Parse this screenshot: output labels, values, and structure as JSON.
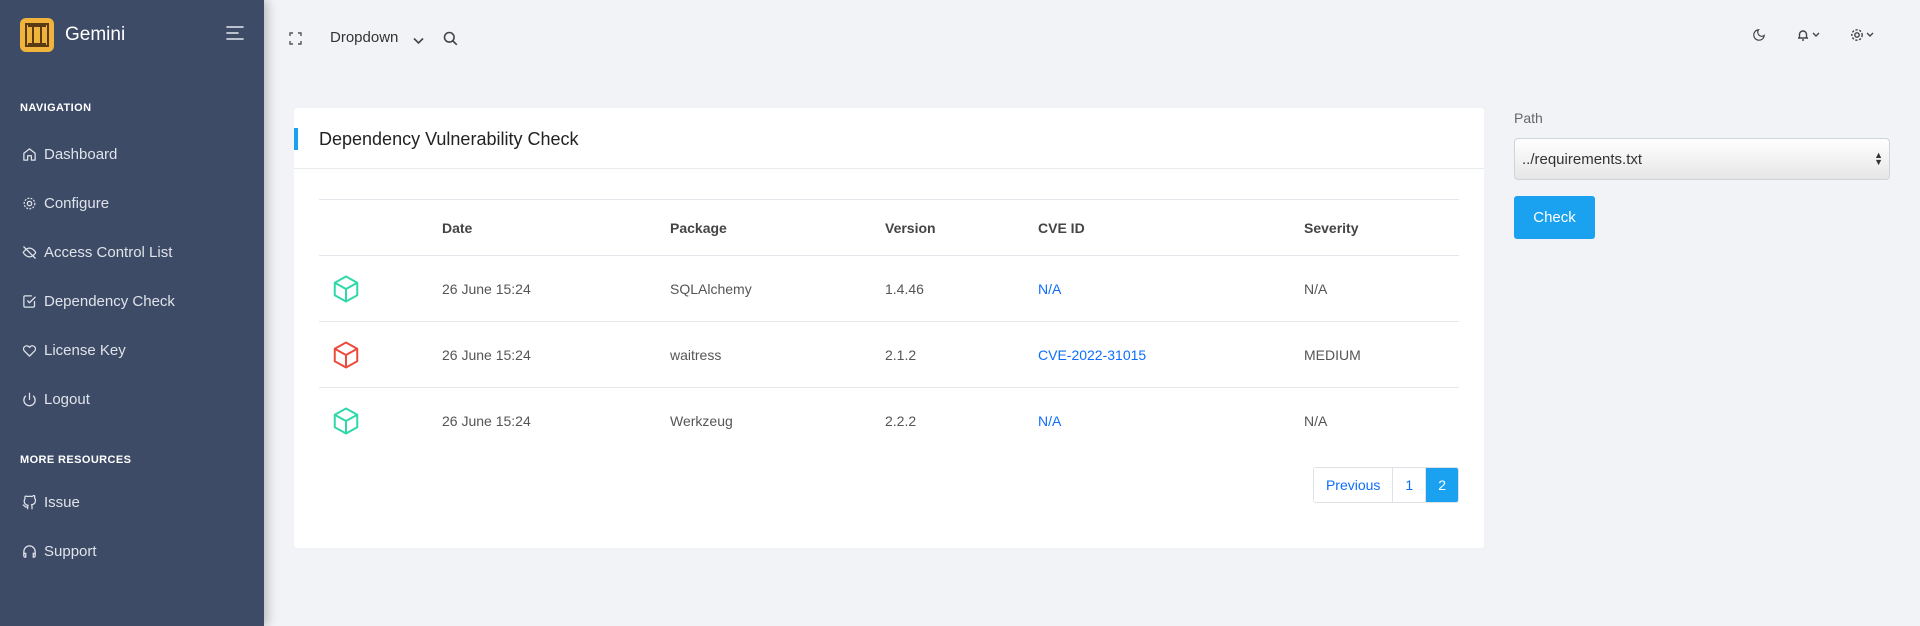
{
  "brand": {
    "name": "Gemini"
  },
  "sidebar": {
    "sections": [
      {
        "title": "NAVIGATION",
        "items": [
          {
            "label": "Dashboard",
            "icon": "home-icon"
          },
          {
            "label": "Configure",
            "icon": "gear-icon"
          },
          {
            "label": "Access Control List",
            "icon": "eye-off-icon"
          },
          {
            "label": "Dependency Check",
            "icon": "check-square-icon"
          },
          {
            "label": "License Key",
            "icon": "heart-icon"
          },
          {
            "label": "Logout",
            "icon": "power-icon"
          }
        ]
      },
      {
        "title": "MORE RESOURCES",
        "items": [
          {
            "label": "Issue",
            "icon": "github-icon"
          },
          {
            "label": "Support",
            "icon": "headphones-icon"
          }
        ]
      }
    ]
  },
  "topbar": {
    "dropdown_label": "Dropdown"
  },
  "card": {
    "title": "Dependency Vulnerability Check",
    "columns": [
      "",
      "Date",
      "Package",
      "Version",
      "CVE ID",
      "Severity"
    ],
    "rows": [
      {
        "status": "safe",
        "status_color": "#2fd8a8",
        "date": "26 June 15:24",
        "package": "SQLAlchemy",
        "version": "1.4.46",
        "cve": "N/A",
        "severity": "N/A"
      },
      {
        "status": "vulnerable",
        "status_color": "#ec4b3c",
        "date": "26 June 15:24",
        "package": "waitress",
        "version": "2.1.2",
        "cve": "CVE-2022-31015",
        "severity": "MEDIUM"
      },
      {
        "status": "safe",
        "status_color": "#2fd8a8",
        "date": "26 June 15:24",
        "package": "Werkzeug",
        "version": "2.2.2",
        "cve": "N/A",
        "severity": "N/A"
      }
    ],
    "pagination": {
      "previous": "Previous",
      "pages": [
        "1",
        "2"
      ],
      "current": "2"
    }
  },
  "form": {
    "path_label": "Path",
    "path_value": "../requirements.txt",
    "check_label": "Check"
  },
  "colors": {
    "sidebar_bg": "#3e4b66",
    "accent": "#1aa1f0",
    "link": "#0d6efd",
    "safe": "#2fd8a8",
    "danger": "#ec4b3c"
  }
}
